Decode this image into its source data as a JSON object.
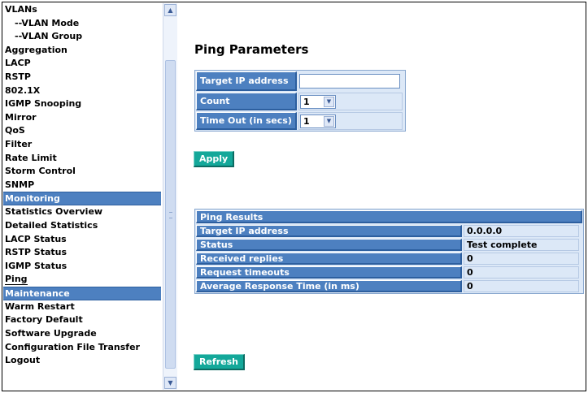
{
  "sidebar": {
    "items": [
      {
        "label": "VLANs",
        "type": "item"
      },
      {
        "label": "--VLAN Mode",
        "type": "sub"
      },
      {
        "label": "--VLAN Group",
        "type": "sub"
      },
      {
        "label": "Aggregation",
        "type": "item"
      },
      {
        "label": "LACP",
        "type": "item"
      },
      {
        "label": "RSTP",
        "type": "item"
      },
      {
        "label": "802.1X",
        "type": "item"
      },
      {
        "label": "IGMP Snooping",
        "type": "item"
      },
      {
        "label": "Mirror",
        "type": "item"
      },
      {
        "label": "QoS",
        "type": "item"
      },
      {
        "label": "Filter",
        "type": "item"
      },
      {
        "label": "Rate Limit",
        "type": "item"
      },
      {
        "label": "Storm Control",
        "type": "item"
      },
      {
        "label": "SNMP",
        "type": "item"
      },
      {
        "label": "Monitoring",
        "type": "header"
      },
      {
        "label": "Statistics Overview",
        "type": "item"
      },
      {
        "label": "Detailed Statistics",
        "type": "item"
      },
      {
        "label": "LACP Status",
        "type": "item"
      },
      {
        "label": "RSTP Status",
        "type": "item"
      },
      {
        "label": "IGMP Status",
        "type": "item"
      },
      {
        "label": "Ping",
        "type": "current"
      },
      {
        "label": "Maintenance",
        "type": "header"
      },
      {
        "label": "Warm Restart",
        "type": "item"
      },
      {
        "label": "Factory Default",
        "type": "item"
      },
      {
        "label": "Software Upgrade",
        "type": "item"
      },
      {
        "label": "Configuration File Transfer",
        "type": "item"
      },
      {
        "label": "Logout",
        "type": "item"
      }
    ]
  },
  "main": {
    "title": "Ping Parameters",
    "params": {
      "target_ip_label": "Target IP address",
      "target_ip_value": "",
      "count_label": "Count",
      "count_value": "1",
      "timeout_label": "Time Out (in secs)",
      "timeout_value": "1"
    },
    "apply_label": "Apply",
    "results": {
      "header": "Ping Results",
      "rows": [
        {
          "label": "Target IP address",
          "value": "0.0.0.0"
        },
        {
          "label": "Status",
          "value": "Test complete"
        },
        {
          "label": "Received replies",
          "value": "0"
        },
        {
          "label": "Request timeouts",
          "value": "0"
        },
        {
          "label": "Average Response Time (in ms)",
          "value": "0"
        }
      ]
    },
    "refresh_label": "Refresh"
  },
  "colors": {
    "label_bg": "#4d80c0",
    "cell_bg": "#dce8f7",
    "button_bg": "#14a89a"
  }
}
